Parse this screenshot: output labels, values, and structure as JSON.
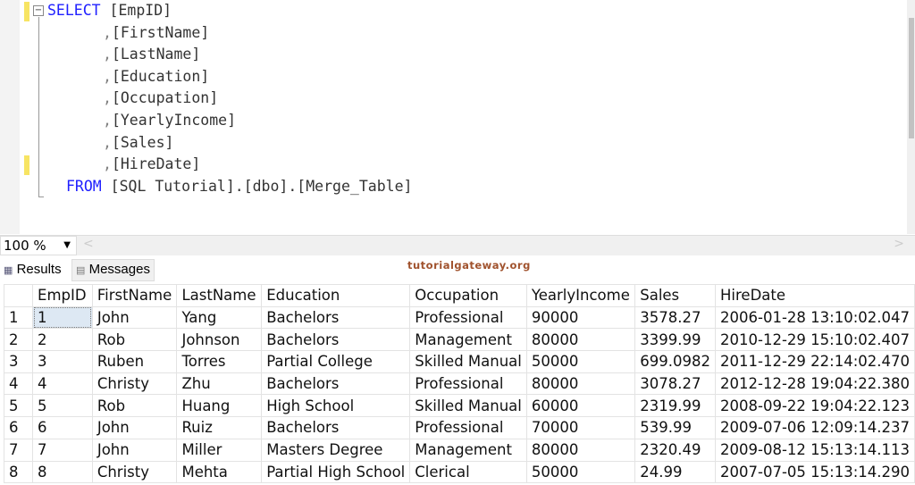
{
  "editor": {
    "lines": [
      {
        "kw": "SELECT",
        "rest": " [EmpID]"
      },
      {
        "pun": ",",
        "rest": "[FirstName]"
      },
      {
        "pun": ",",
        "rest": "[LastName]"
      },
      {
        "pun": ",",
        "rest": "[Education]"
      },
      {
        "pun": ",",
        "rest": "[Occupation]"
      },
      {
        "pun": ",",
        "rest": "[YearlyIncome]"
      },
      {
        "pun": ",",
        "rest": "[Sales]"
      },
      {
        "pun": ",",
        "rest": "[HireDate]"
      },
      {
        "kw": "FROM",
        "rest": " [SQL Tutorial].[dbo].[Merge_Table]"
      }
    ]
  },
  "zoom": {
    "value": "100 %"
  },
  "tabs": {
    "results": "Results",
    "messages": "Messages"
  },
  "watermark": "tutorialgateway.org",
  "grid": {
    "columns": [
      "",
      "EmpID",
      "FirstName",
      "LastName",
      "Education",
      "Occupation",
      "YearlyIncome",
      "Sales",
      "HireDate"
    ],
    "rows": [
      [
        "1",
        "1",
        "John",
        "Yang",
        "Bachelors",
        "Professional",
        "90000",
        "3578.27",
        "2006-01-28 13:10:02.047"
      ],
      [
        "2",
        "2",
        "Rob",
        "Johnson",
        "Bachelors",
        "Management",
        "80000",
        "3399.99",
        "2010-12-29 15:10:02.407"
      ],
      [
        "3",
        "3",
        "Ruben",
        "Torres",
        "Partial College",
        "Skilled Manual",
        "50000",
        "699.0982",
        "2011-12-29 22:14:02.470"
      ],
      [
        "4",
        "4",
        "Christy",
        "Zhu",
        "Bachelors",
        "Professional",
        "80000",
        "3078.27",
        "2012-12-28 19:04:22.380"
      ],
      [
        "5",
        "5",
        "Rob",
        "Huang",
        "High School",
        "Skilled Manual",
        "60000",
        "2319.99",
        "2008-09-22 19:04:22.123"
      ],
      [
        "6",
        "6",
        "John",
        "Ruiz",
        "Bachelors",
        "Professional",
        "70000",
        "539.99",
        "2009-07-06 12:09:14.237"
      ],
      [
        "7",
        "7",
        "John",
        "Miller",
        "Masters Degree",
        "Management",
        "80000",
        "2320.49",
        "2009-08-12 15:13:14.113"
      ],
      [
        "8",
        "8",
        "Christy",
        "Mehta",
        "Partial High School",
        "Clerical",
        "50000",
        "24.99",
        "2007-07-05 15:13:14.290"
      ]
    ]
  }
}
